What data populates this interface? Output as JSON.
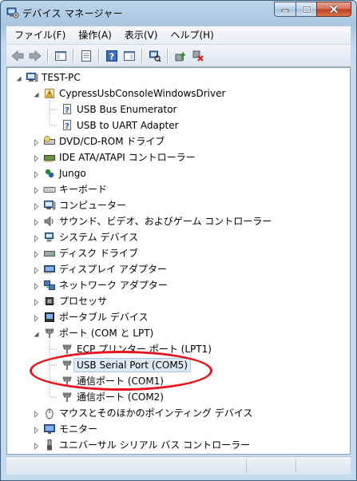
{
  "window": {
    "title": "デバイス マネージャー"
  },
  "menu": [
    {
      "id": "file",
      "label": "ファイル(F)"
    },
    {
      "id": "action",
      "label": "操作(A)"
    },
    {
      "id": "view",
      "label": "表示(V)"
    },
    {
      "id": "help",
      "label": "ヘルプ(H)"
    }
  ],
  "toolbar": {
    "buttons": [
      "back-arrow-icon",
      "forward-arrow-icon",
      "console-tree-icon",
      "properties-icon",
      "help-icon",
      "action-pane-icon",
      "scan-hardware-icon",
      "update-driver-icon",
      "uninstall-icon"
    ]
  },
  "tree": {
    "root": "TEST-PC",
    "items": [
      {
        "label": "CypressUsbConsoleWindowsDriver",
        "level": 1,
        "expanded": true,
        "icon": "warning-device-icon"
      },
      {
        "label": "USB Bus Enumerator",
        "level": 2,
        "icon": "unknown-device-icon"
      },
      {
        "label": "USB to UART Adapter",
        "level": 2,
        "icon": "unknown-device-icon"
      },
      {
        "label": "DVD/CD-ROM ドライブ",
        "level": 1,
        "expanded": false,
        "icon": "dvd-drive-icon"
      },
      {
        "label": "IDE ATA/ATAPI コントローラー",
        "level": 1,
        "expanded": false,
        "icon": "ide-controller-icon"
      },
      {
        "label": "Jungo",
        "level": 1,
        "expanded": false,
        "icon": "jungo-icon"
      },
      {
        "label": "キーボード",
        "level": 1,
        "expanded": false,
        "icon": "keyboard-icon"
      },
      {
        "label": "コンピューター",
        "level": 1,
        "expanded": false,
        "icon": "computer-icon"
      },
      {
        "label": "サウンド、ビデオ、およびゲーム コントローラー",
        "level": 1,
        "expanded": false,
        "icon": "sound-icon"
      },
      {
        "label": "システム デバイス",
        "level": 1,
        "expanded": false,
        "icon": "system-device-icon"
      },
      {
        "label": "ディスク ドライブ",
        "level": 1,
        "expanded": false,
        "icon": "disk-drive-icon"
      },
      {
        "label": "ディスプレイ アダプター",
        "level": 1,
        "expanded": false,
        "icon": "display-adapter-icon"
      },
      {
        "label": "ネットワーク アダプター",
        "level": 1,
        "expanded": false,
        "icon": "network-adapter-icon"
      },
      {
        "label": "プロセッサ",
        "level": 1,
        "expanded": false,
        "icon": "processor-icon"
      },
      {
        "label": "ポータブル デバイス",
        "level": 1,
        "expanded": false,
        "icon": "portable-device-icon"
      },
      {
        "label": "ポート (COM と LPT)",
        "level": 1,
        "expanded": true,
        "icon": "port-icon"
      },
      {
        "label": "ECP プリンター ポート (LPT1)",
        "level": 2,
        "icon": "port-icon"
      },
      {
        "label": "USB Serial Port (COM5)",
        "level": 2,
        "icon": "port-icon",
        "selected": true
      },
      {
        "label": "通信ポート (COM1)",
        "level": 2,
        "icon": "port-icon"
      },
      {
        "label": "通信ポート (COM2)",
        "level": 2,
        "icon": "port-icon"
      },
      {
        "label": "マウスとそのほかのポインティング デバイス",
        "level": 1,
        "expanded": false,
        "icon": "mouse-icon"
      },
      {
        "label": "モニター",
        "level": 1,
        "expanded": false,
        "icon": "monitor-icon"
      },
      {
        "label": "ユニバーサル シリアル バス コントローラー",
        "level": 1,
        "expanded": false,
        "icon": "usb-controller-icon"
      }
    ]
  },
  "annotation": {
    "color": "#e4161b",
    "target": "USB Serial Port (COM5)"
  },
  "colors": {
    "selection": "#dfeaf7",
    "frame": "#c6dbee"
  }
}
